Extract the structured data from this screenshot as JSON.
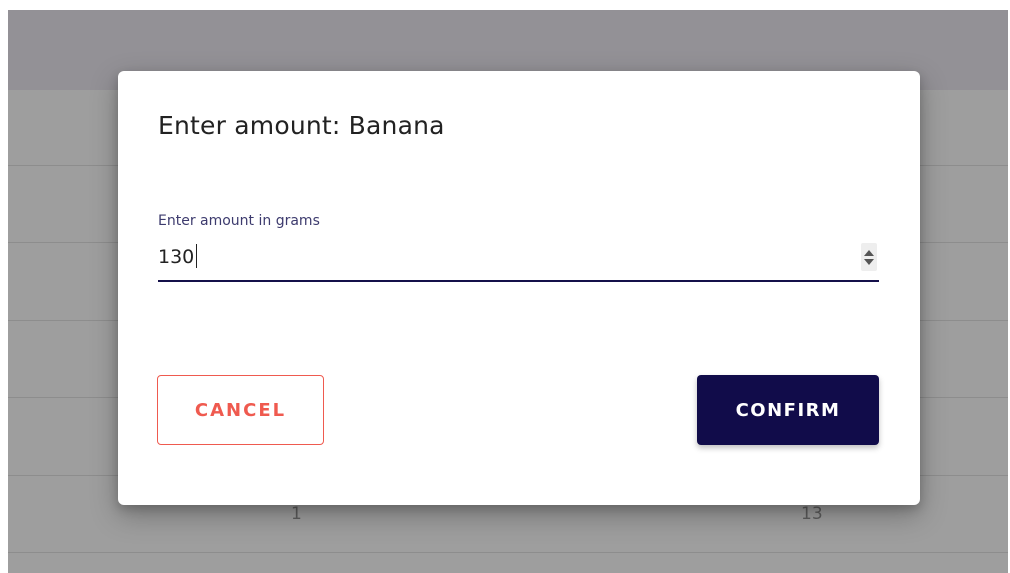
{
  "background_table": {
    "visible_cells": [
      "1",
      "13"
    ]
  },
  "dialog": {
    "title": "Enter amount: Banana",
    "field": {
      "label": "Enter amount in grams",
      "value": "130"
    },
    "buttons": {
      "cancel_label": "CANCEL",
      "confirm_label": "CONFIRM"
    }
  },
  "colors": {
    "primary": "#110c4a",
    "cancel": "#ef5a4f",
    "overlay": "#9e9e9e",
    "label": "#3d3b6e"
  },
  "icons": {
    "spinner_up": "chevron-up-icon",
    "spinner_down": "chevron-down-icon"
  }
}
